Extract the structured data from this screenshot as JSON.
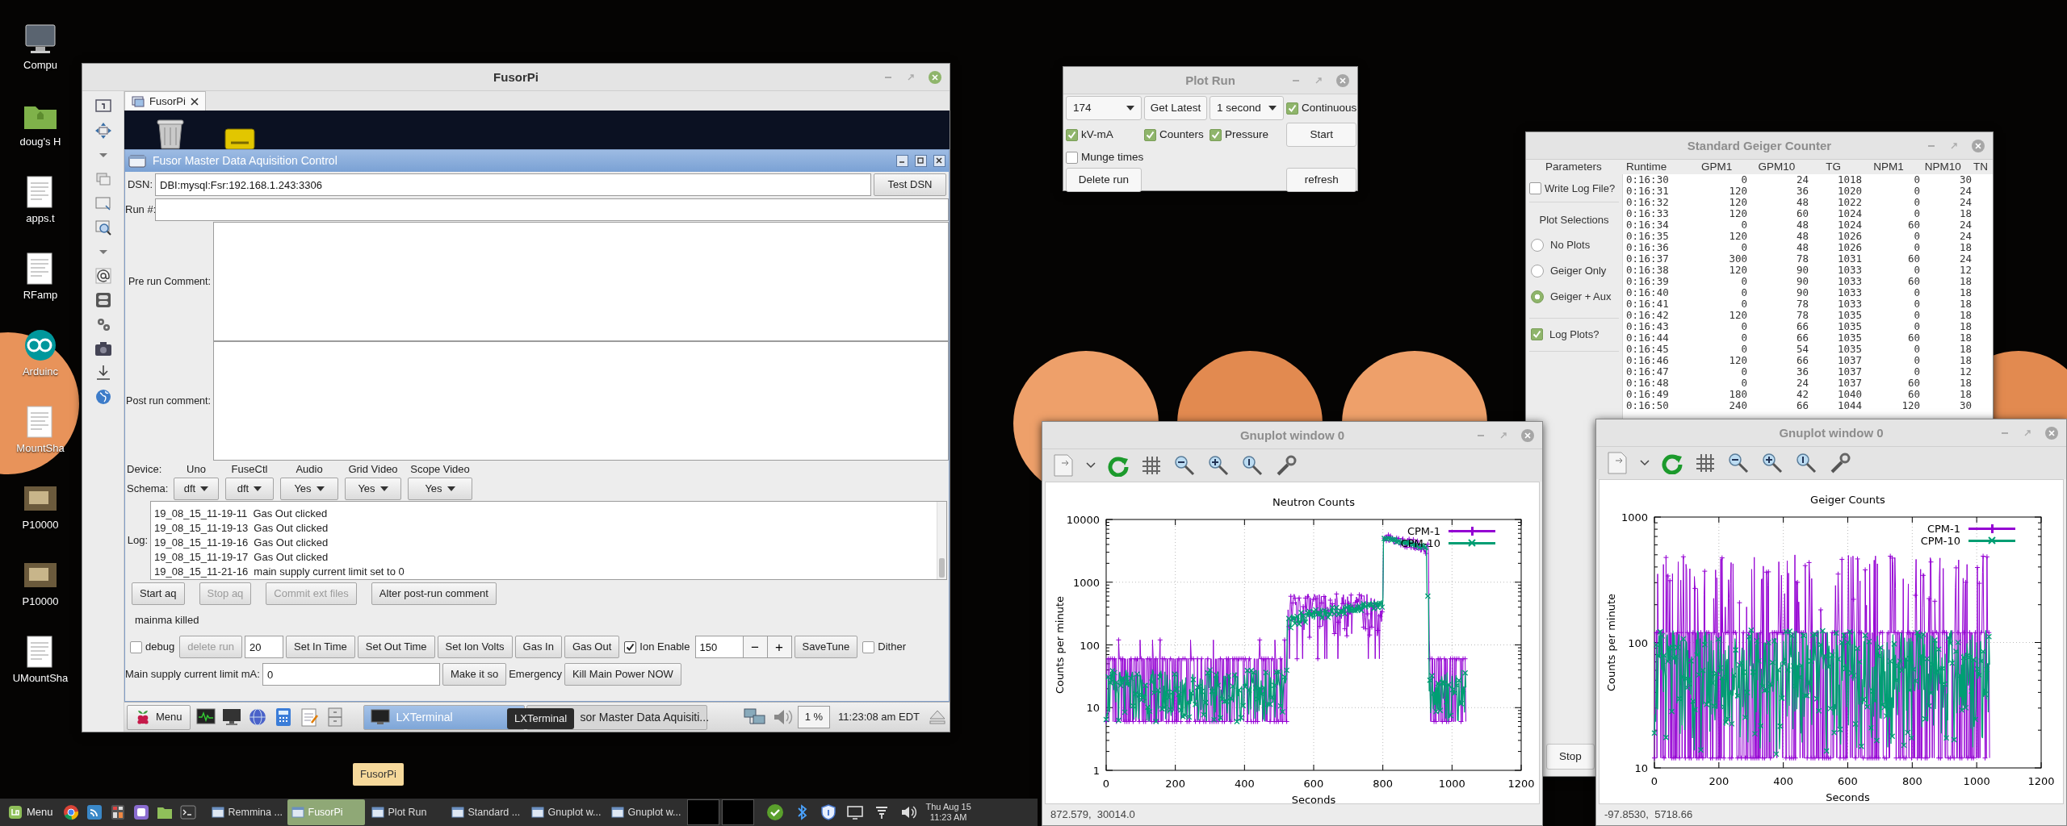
{
  "desktop_icons": [
    {
      "kind": "computer",
      "label": "Compu"
    },
    {
      "kind": "folder",
      "label": "doug's H"
    },
    {
      "kind": "document",
      "label": "apps.t"
    },
    {
      "kind": "document",
      "label": "RFamp"
    },
    {
      "kind": "arduino",
      "label": "Arduinc"
    },
    {
      "kind": "document",
      "label": "MountSha"
    },
    {
      "kind": "photo",
      "label": "P10000"
    },
    {
      "kind": "photo",
      "label": "P10000"
    },
    {
      "kind": "document",
      "label": "UMountSha"
    }
  ],
  "fusorpi": {
    "title": "FusorPi",
    "active": true,
    "tab": {
      "label": "FusorPi",
      "selected": true
    },
    "daq": {
      "title": "Fusor Master Data Aquisition Control",
      "dsn": {
        "label": "DSN:",
        "value": "DBI:mysql:Fsr:192.168.1.243:3306",
        "button": "Test DSN"
      },
      "run": {
        "label": "Run #:"
      },
      "pre_comment": {
        "label": "Pre run Comment:"
      },
      "post_comment": {
        "label": "Post run comment:"
      },
      "device_label": "Device:",
      "schema_label": "Schema:",
      "devices": [
        {
          "name": "Uno",
          "value": "dft"
        },
        {
          "name": "FuseCtl",
          "value": "dft"
        },
        {
          "name": "Audio",
          "value": "Yes"
        },
        {
          "name": "Grid Video",
          "value": "Yes"
        },
        {
          "name": "Scope Video",
          "value": "Yes"
        }
      ],
      "log_label": "Log:",
      "log": [
        "19_08_15_11-19-11  Gas Out clicked",
        "19_08_15_11-19-13  Gas Out clicked",
        "19_08_15_11-19-16  Gas Out clicked",
        "19_08_15_11-19-17  Gas Out clicked",
        "19_08_15_11-21-16  main supply current limit set to 0"
      ],
      "actions": [
        {
          "label": "Start aq",
          "disabled": false
        },
        {
          "label": "Stop aq",
          "disabled": true
        },
        {
          "label": "Commit ext files",
          "disabled": true
        },
        {
          "label": "Alter post-run comment",
          "disabled": false
        }
      ],
      "status": "mainma killed",
      "controls": [
        {
          "kind": "checkbox",
          "label": "debug",
          "checked": false
        },
        {
          "kind": "button",
          "label": "delete run",
          "disabled": true
        },
        {
          "kind": "field",
          "value": "20"
        },
        {
          "kind": "button",
          "label": "Set In Time",
          "disabled": false
        },
        {
          "kind": "button",
          "label": "Set Out Time",
          "disabled": false
        },
        {
          "kind": "button",
          "label": "Set Ion Volts",
          "disabled": false
        },
        {
          "kind": "button",
          "label": "Gas In",
          "disabled": false
        },
        {
          "kind": "button",
          "label": "Gas Out",
          "disabled": false
        },
        {
          "kind": "checkbox",
          "label": "Ion Enable",
          "checked": true
        },
        {
          "kind": "spin",
          "value": "150",
          "minus": "−",
          "plus": "+"
        },
        {
          "kind": "button",
          "label": "SaveTune",
          "disabled": false
        },
        {
          "kind": "checkbox",
          "label": "Dither",
          "checked": false
        }
      ],
      "limit": {
        "label": "Main supply current limit mA:",
        "value": "0",
        "button": "Make it so",
        "emergency_label": "Emergency",
        "kill_button": "Kill Main Power NOW"
      }
    },
    "panel": {
      "menu": "Menu",
      "tasks": [
        {
          "label": "LXTerminal",
          "selected": true
        },
        {
          "label": "sor Master Data Aquisiti...",
          "selected": false
        }
      ],
      "cpu": "1 %",
      "clock": "11:23:08 am EDT",
      "tooltip": "LXTerminal"
    }
  },
  "plot_run": {
    "title": "Plot Run",
    "active": false,
    "run_select": "174",
    "get_latest": "Get Latest",
    "interval_select": "1 second",
    "options": [
      {
        "label": "Continuous",
        "checked": true
      },
      {
        "label": "kV-mA",
        "checked": true
      },
      {
        "label": "Counters",
        "checked": true
      },
      {
        "label": "Pressure",
        "checked": true
      },
      {
        "label": "Munge times",
        "checked": false
      }
    ],
    "start": "Start",
    "delete": "Delete run",
    "refresh": "refresh"
  },
  "geiger": {
    "title": "Standard Geiger Counter",
    "active": false,
    "parameters": "Parameters",
    "write_log": {
      "label": "Write Log File?",
      "checked": false
    },
    "plot_heading": "Plot Selections",
    "plot_options": [
      {
        "label": "No Plots",
        "selected": false
      },
      {
        "label": "Geiger Only",
        "selected": false
      },
      {
        "label": "Geiger + Aux",
        "selected": true
      }
    ],
    "log_plots": {
      "label": "Log Plots?",
      "checked": true
    },
    "stop": "Stop",
    "table": {
      "columns": [
        "Runtime",
        "GPM1",
        "GPM10",
        "TG",
        "NPM1",
        "NPM10",
        "TN"
      ],
      "rows": [
        [
          "0:16:30",
          "0",
          "24",
          "1018",
          "0",
          "30"
        ],
        [
          "0:16:31",
          "120",
          "36",
          "1020",
          "0",
          "24"
        ],
        [
          "0:16:32",
          "120",
          "48",
          "1022",
          "0",
          "24"
        ],
        [
          "0:16:33",
          "120",
          "60",
          "1024",
          "0",
          "18"
        ],
        [
          "0:16:34",
          "0",
          "48",
          "1024",
          "60",
          "24"
        ],
        [
          "0:16:35",
          "120",
          "48",
          "1026",
          "0",
          "24"
        ],
        [
          "0:16:36",
          "0",
          "48",
          "1026",
          "0",
          "18"
        ],
        [
          "0:16:37",
          "300",
          "78",
          "1031",
          "60",
          "24"
        ],
        [
          "0:16:38",
          "120",
          "90",
          "1033",
          "0",
          "12"
        ],
        [
          "0:16:39",
          "0",
          "90",
          "1033",
          "60",
          "18"
        ],
        [
          "0:16:40",
          "0",
          "90",
          "1033",
          "0",
          "18"
        ],
        [
          "0:16:41",
          "0",
          "78",
          "1033",
          "0",
          "18"
        ],
        [
          "0:16:42",
          "120",
          "78",
          "1035",
          "0",
          "18"
        ],
        [
          "0:16:43",
          "0",
          "66",
          "1035",
          "0",
          "18"
        ],
        [
          "0:16:44",
          "0",
          "66",
          "1035",
          "60",
          "18"
        ],
        [
          "0:16:45",
          "0",
          "54",
          "1035",
          "0",
          "18"
        ],
        [
          "0:16:46",
          "120",
          "66",
          "1037",
          "0",
          "18"
        ],
        [
          "0:16:47",
          "0",
          "36",
          "1037",
          "0",
          "12"
        ],
        [
          "0:16:48",
          "0",
          "24",
          "1037",
          "60",
          "18"
        ],
        [
          "0:16:49",
          "180",
          "42",
          "1040",
          "60",
          "18"
        ],
        [
          "0:16:50",
          "240",
          "66",
          "1044",
          "120",
          "30"
        ]
      ]
    }
  },
  "gnuplots": [
    {
      "kind": "neutron",
      "title": "Gnuplot window 0",
      "active": false,
      "plot_title": "Neutron Counts",
      "ylabel": "Counts per minute",
      "xlabel": "Seconds",
      "xticks": [
        "0",
        "200",
        "400",
        "600",
        "800",
        "1000",
        "1200"
      ],
      "yticks": [
        "10000",
        "1000",
        "100",
        "10",
        "1"
      ],
      "legend": [
        {
          "name": "CPM-1",
          "color": "#9400d3"
        },
        {
          "name": "CPM-10",
          "color": "#009e73"
        }
      ],
      "status": "872.579,  30014.0"
    },
    {
      "kind": "geiger",
      "title": "Gnuplot window 0",
      "active": false,
      "plot_title": "Geiger Counts",
      "ylabel": "Counts per minute",
      "xlabel": "Seconds",
      "xticks": [
        "0",
        "200",
        "400",
        "600",
        "800",
        "1000",
        "1200"
      ],
      "yticks": [
        "1000",
        "100",
        "10"
      ],
      "legend": [
        {
          "name": "CPM-1",
          "color": "#9400d3"
        },
        {
          "name": "CPM-10",
          "color": "#009e73"
        }
      ],
      "status": "-97.8530,  5718.66"
    }
  ],
  "taskbar": {
    "menu": "Menu",
    "tasks": [
      {
        "label": "Remmina ...",
        "selected": false
      },
      {
        "label": "FusorPi",
        "selected": true
      },
      {
        "label": "Plot Run",
        "selected": false
      },
      {
        "label": "Standard ...",
        "selected": false
      },
      {
        "label": "Gnuplot w...",
        "selected": false
      },
      {
        "label": "Gnuplot w...",
        "selected": false
      }
    ],
    "date": "Thu Aug 15",
    "time": "11:23 AM",
    "tooltip": "FusorPi"
  }
}
